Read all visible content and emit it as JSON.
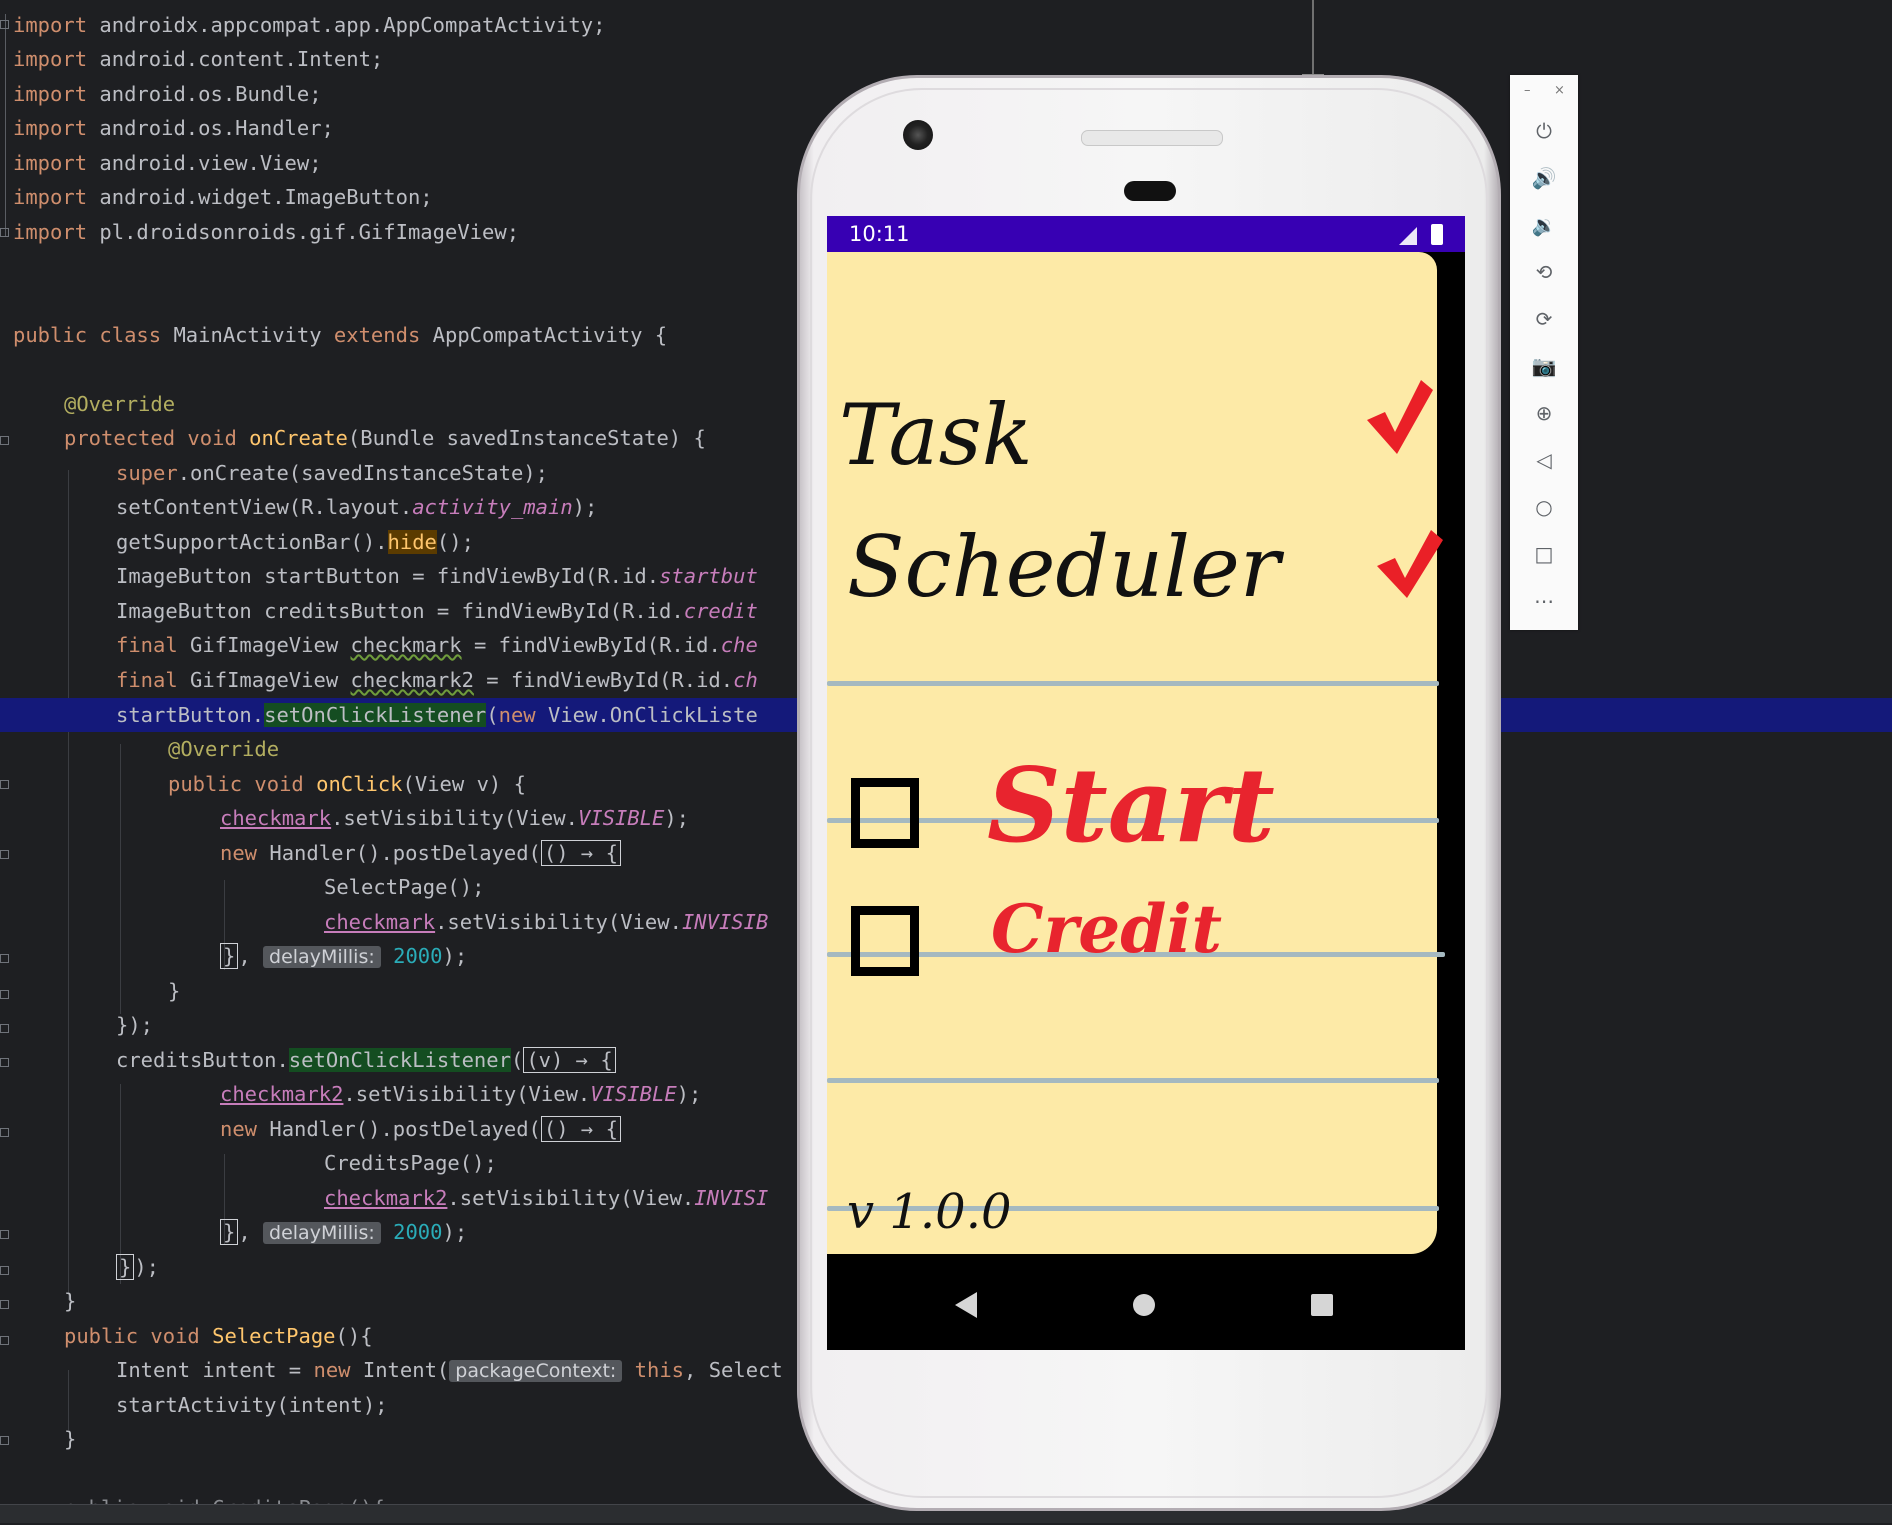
{
  "code": {
    "lines": [
      {
        "y": 8,
        "indent": 0,
        "parts": [
          [
            "kw",
            "import"
          ],
          [
            "",
            "androidx.appcompat.app.AppCompatActivity;"
          ]
        ]
      },
      {
        "y": 42,
        "indent": 0,
        "parts": [
          [
            "kw",
            "import"
          ],
          [
            "",
            "android.content.Intent;"
          ]
        ]
      }
    ],
    "l1_kw": "import",
    "l1_txt": " androidx.appcompat.app.AppCompatActivity;",
    "l2_kw": "import",
    "l2_txt": " android.content.Intent;",
    "l3_kw": "import",
    "l3_txt": " android.os.Bundle;",
    "l4_kw": "import",
    "l4_txt": " android.os.Handler;",
    "l5_kw": "import",
    "l5_txt": " android.view.View;",
    "l6_kw": "import",
    "l6_txt": " android.widget.ImageButton;",
    "l7_kw": "import",
    "l7_txt": " pl.droidsonroids.gif.GifImageView;",
    "class_kw1": "public class",
    "class_name": " MainActivity ",
    "class_kw2": "extends",
    "class_rest": " AppCompatActivity {",
    "override": "@Override",
    "oncreate_kw": "protected void",
    "oncreate_name": " onCreate",
    "oncreate_rest": "(Bundle savedInstanceState) {",
    "super_kw": "super",
    "super_rest": ".onCreate(savedInstanceState);",
    "setcontent_a": "setContentView(R.layout.",
    "setcontent_f": "activity_main",
    "setcontent_b": ");",
    "getsupport_a": "getSupportActionBar().",
    "getsupport_h": "hide",
    "getsupport_b": "();",
    "start_decl_a": "ImageButton startButton = findViewById(R.id.",
    "start_decl_f": "startbut",
    "credits_decl_a": "ImageButton creditsButton = findViewById(R.id.",
    "credits_decl_f": "credit",
    "final_kw": "final",
    "check1_a": " GifImageView ",
    "check1_v": "checkmark",
    "check1_b": " = findViewById(R.id.",
    "check1_f": "che",
    "check2_a": " GifImageView ",
    "check2_v": "checkmark2",
    "check2_b": " = findViewById(R.id.",
    "check2_f": "ch",
    "startbtn_a": "startButton.",
    "startbtn_m": "setOnClickListener",
    "startbtn_b": "(",
    "new_kw": "new",
    "startbtn_c": " View.OnClickListe",
    "onclick_kw": "public void",
    "onclick_name": " onClick",
    "onclick_rest": "(View v) {",
    "ck1_vis_v": "checkmark",
    "ck1_vis_a": ".setVisibility(View.",
    "ck1_vis_f": "VISIBLE",
    "ck1_vis_b": ");",
    "handler_a": " Handler().postDelayed(",
    "lambda0": "() → {",
    "selectpage_call": "SelectPage();",
    "ck1_inv_v": "checkmark",
    "ck1_inv_a": ".setVisibility(View.",
    "ck1_inv_f": "INVISIB",
    "close_brace_lam": "}",
    "delay_hint": "delayMillis:",
    "delay_val": "2000",
    "close_paren": ");",
    "close_brace": "}",
    "close_listener": "});",
    "credbtn_a": "creditsButton.",
    "credbtn_m": "setOnClickListener",
    "credbtn_b": "(",
    "lambda_v": "(v) → {",
    "ck2_vis_v": "checkmark2",
    "ck2_vis_a": ".setVisibility(View.",
    "ck2_vis_f": "VISIBLE",
    "ck2_vis_b": ");",
    "creditspage_call": "CreditsPage();",
    "ck2_inv_v": "checkmark2",
    "ck2_inv_a": ".setVisibility(View.",
    "ck2_inv_f": "INVISI",
    "close_lam_paren": "});",
    "selectpage_kw": "public void",
    "selectpage_name": " SelectPage",
    "selectpage_rest": "(){",
    "intent_a": "Intent intent = ",
    "intent_new": "new",
    "intent_b": " Intent(",
    "intent_hint": "packageContext:",
    "intent_this": " this",
    "intent_c": ", Select",
    "startactivity": "startActivity(intent);",
    "creditspage_decl": "public void CreditsPage(){"
  },
  "device": {
    "status_time": "10:11",
    "title_task": "Task",
    "title_scheduler": "Scheduler",
    "start_label": "Start",
    "credit_label": "Credit",
    "version": "v 1.0.0"
  },
  "emulator_toolbar": {
    "minimize": "–",
    "close": "×",
    "buttons": [
      "power-icon",
      "volume-up-icon",
      "volume-down-icon",
      "rotate-left-icon",
      "rotate-right-icon",
      "camera-icon",
      "zoom-icon",
      "back-icon",
      "home-icon",
      "overview-icon",
      "more-icon"
    ]
  },
  "colors": {
    "status_bar": "#3700b3",
    "note_paper": "#fdeaa7",
    "check_red": "#ea2027",
    "start_red": "#e8242e"
  }
}
